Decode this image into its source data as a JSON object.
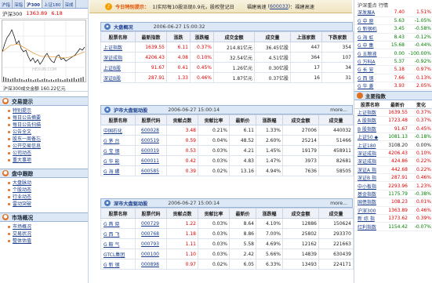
{
  "left": {
    "tabs": [
      "沪指",
      "深指",
      "沪300",
      "上证180",
      "深成"
    ],
    "index": {
      "name": "沪深300",
      "value": "1363.89",
      "change": "6.18"
    },
    "chart_watermark": "HEXUN.COM",
    "volume_label": "沪深300成交金额 160.22亿元",
    "sections": [
      {
        "title": "交易提示",
        "items": [
          "特别提示",
          "每日公告摘要",
          "每日公告扫描",
          "公告全文",
          "股东一周备忘",
          "公开交易信息",
          "公司动态",
          "重大事项"
        ]
      },
      {
        "title": "盘中跟踪",
        "items": [
          "大盘脉动",
          "个股动态",
          "行业动态",
          "雷动突破"
        ]
      },
      {
        "title": "市场概况",
        "items": [
          "市场概况",
          "交易状况",
          "整体估值"
        ]
      }
    ]
  },
  "topbar": {
    "label": "今日特别提示：",
    "text": "1)实际每10股派现0.9元，股权登记日",
    "stock_name": "福建高速",
    "stock_code": "600033",
    "tail": "：福建高速"
  },
  "overview": {
    "title": "大盘概况",
    "datetime": "2006-06-27  15:00:32",
    "headers": [
      "股票名称",
      "最新指数",
      "涨跌",
      "涨跌幅",
      "成交金额",
      "成交量",
      "上涨家数",
      "下跌家数"
    ],
    "rows": [
      {
        "name": "上证指数",
        "latest": "1639.55",
        "chg": "6.11",
        "pct": "0.37%",
        "amount": "214.81亿元",
        "vol": "36.45亿股",
        "up": "447",
        "down": "354",
        "dir": "up"
      },
      {
        "name": "深证成指",
        "latest": "4206.43",
        "chg": "4.08",
        "pct": "0.10%",
        "amount": "32.54亿元",
        "vol": "4.51亿股",
        "up": "364",
        "down": "107",
        "dir": "up"
      },
      {
        "name": "上证B股",
        "latest": "91.67",
        "chg": "0.41",
        "pct": "0.45%",
        "amount": "1.26亿元",
        "vol": "0.30亿股",
        "up": "17",
        "down": "34",
        "dir": "up"
      },
      {
        "name": "深证B股",
        "latest": "287.91",
        "chg": "1.33",
        "pct": "0.46%",
        "amount": "1.87亿元",
        "vol": "0.37亿股",
        "up": "16",
        "down": "31",
        "dir": "up"
      }
    ]
  },
  "sh_movers": {
    "title": "沪市大盘驱动股",
    "datetime": "2006-06-27  15:00:14",
    "more": "more...",
    "headers": [
      "股票名称",
      "股票代码",
      "贡献点数",
      "贡献比率",
      "最新价",
      "涨跌幅",
      "成交金额",
      "成交量"
    ],
    "rows": [
      {
        "name": "中国石化",
        "code": "600028",
        "pts": "3.48",
        "ratio": "0.21%",
        "price": "6.11",
        "pct": "1.33%",
        "amount": "27006",
        "vol": "440032",
        "dir": "up"
      },
      {
        "name": "G 茅 台",
        "code": "600519",
        "pts": "0.59",
        "ratio": "0.04%",
        "price": "48.52",
        "pct": "2.60%",
        "amount": "25214",
        "vol": "51466",
        "dir": "up"
      },
      {
        "name": "G 宝 钢",
        "code": "600019",
        "pts": "0.53",
        "ratio": "0.03%",
        "price": "4.21",
        "pct": "1.45%",
        "amount": "19179",
        "vol": "458911",
        "dir": "up"
      },
      {
        "name": "G 华 能",
        "code": "600011",
        "pts": "0.42",
        "ratio": "0.03%",
        "price": "4.83",
        "pct": "1.47%",
        "amount": "3973",
        "vol": "82681",
        "dir": "up"
      },
      {
        "name": "G 海 螺",
        "code": "600585",
        "pts": "0.39",
        "ratio": "0.02%",
        "price": "13.16",
        "pct": "4.94%",
        "amount": "7636",
        "vol": "58505",
        "dir": "up"
      }
    ]
  },
  "sz_movers": {
    "title": "深市大盘驱动股",
    "datetime": "2006-06-27  15:00:14",
    "more": "more...",
    "headers": [
      "股票名称",
      "股票代码",
      "贡献点数",
      "贡献比率",
      "最新价",
      "涨跌幅",
      "成交金额",
      "成交量"
    ],
    "rows": [
      {
        "name": "G 燕 晓",
        "code": "000729",
        "pts": "1.22",
        "ratio": "0.03%",
        "price": "8.64",
        "pct": "4.10%",
        "amount": "12886",
        "vol": "150624",
        "dir": "up"
      },
      {
        "name": "G 西 飞",
        "code": "000768",
        "pts": "1.18",
        "ratio": "0.03%",
        "price": "8.86",
        "pct": "7.00%",
        "amount": "25802",
        "vol": "293370",
        "dir": "up"
      },
      {
        "name": "G 鞍 气",
        "code": "000793",
        "pts": "1.11",
        "ratio": "0.03%",
        "price": "5.58",
        "pct": "4.69%",
        "amount": "12162",
        "vol": "221663",
        "dir": "up"
      },
      {
        "name": "GTCL集团",
        "code": "000100",
        "pts": "1.10",
        "ratio": "0.03%",
        "price": "2.42",
        "pct": "5.66%",
        "amount": "14839",
        "vol": "630439",
        "dir": "up"
      },
      {
        "name": "G 新 钢",
        "code": "000898",
        "pts": "0.97",
        "ratio": "0.02%",
        "price": "6.05",
        "pct": "6.33%",
        "amount": "13493",
        "vol": "224171",
        "dir": "up"
      }
    ]
  },
  "right": {
    "header": "沪深重点 行情",
    "list1": [
      {
        "name": "深发展A",
        "price": "7.40",
        "pct": "1.51%",
        "dir": "up"
      },
      {
        "name": "G 中 原",
        "price": "5.63",
        "pct": "-1.05%",
        "dir": "down"
      },
      {
        "name": "G 新钢机",
        "price": "3.45",
        "pct": "-0.58%",
        "dir": "down"
      },
      {
        "name": "G 海 虹",
        "price": "8.43",
        "pct": "-0.12%",
        "dir": "down"
      },
      {
        "name": "G 中 集",
        "price": "15.68",
        "pct": "-0.44%",
        "dir": "down"
      },
      {
        "name": "G 五粮液",
        "price": "0.00",
        "pct": "-100.00%",
        "dir": "down"
      },
      {
        "name": "G 万科A",
        "price": "5.37",
        "pct": "-0.92%",
        "dir": "down"
      },
      {
        "name": "G 长 安",
        "price": "5.18",
        "pct": "0.97%",
        "dir": "up"
      },
      {
        "name": "G 西 钢",
        "price": "7.66",
        "pct": "0.13%",
        "dir": "up"
      },
      {
        "name": "G 华 菱",
        "price": "3.93",
        "pct": "2.05%",
        "dir": "up"
      }
    ],
    "section2": "主要指数",
    "list2_headers": [
      "股票名称",
      "最新价",
      "变化"
    ],
    "list2": [
      {
        "name": "上证指数",
        "price": "1639.55",
        "pct": "0.37%",
        "dir": "up"
      },
      {
        "name": "A 股指数",
        "price": "1723.48",
        "pct": "0.37%",
        "dir": "up"
      },
      {
        "name": "B 股指数",
        "price": "91.67",
        "pct": "0.45%",
        "dir": "up"
      },
      {
        "name": "上证50 ◆",
        "price": "1081.13",
        "pct": "-0.18%",
        "dir": "down"
      },
      {
        "name": "上证180",
        "price": "3108.20",
        "pct": "0.00%",
        "dir": "flat"
      },
      {
        "name": "深证成指",
        "price": "4206.43",
        "pct": "0.10%",
        "dir": "up"
      },
      {
        "name": "深证成指",
        "price": "424.86",
        "pct": "0.22%",
        "dir": "up"
      },
      {
        "name": "深证A 指",
        "price": "442.68",
        "pct": "0.22%",
        "dir": "up"
      },
      {
        "name": "深证B 指",
        "price": "287.91",
        "pct": "0.46%",
        "dir": "up"
      },
      {
        "name": "中小板指",
        "price": "2293.96",
        "pct": "1.23%",
        "dir": "up"
      },
      {
        "name": "基金指数",
        "price": "1175.79",
        "pct": "-0.38%",
        "dir": "down"
      },
      {
        "name": "国债指数",
        "price": "108.23",
        "pct": "0.01%",
        "dir": "up"
      },
      {
        "name": "沪深300",
        "price": "1363.89",
        "pct": "0.46%",
        "dir": "up"
      },
      {
        "name": "新 综 指",
        "price": "1373.62",
        "pct": "0.39%",
        "dir": "up"
      },
      {
        "name": "红利指数",
        "price": "1154.42",
        "pct": "-0.07%",
        "dir": "down"
      }
    ]
  }
}
